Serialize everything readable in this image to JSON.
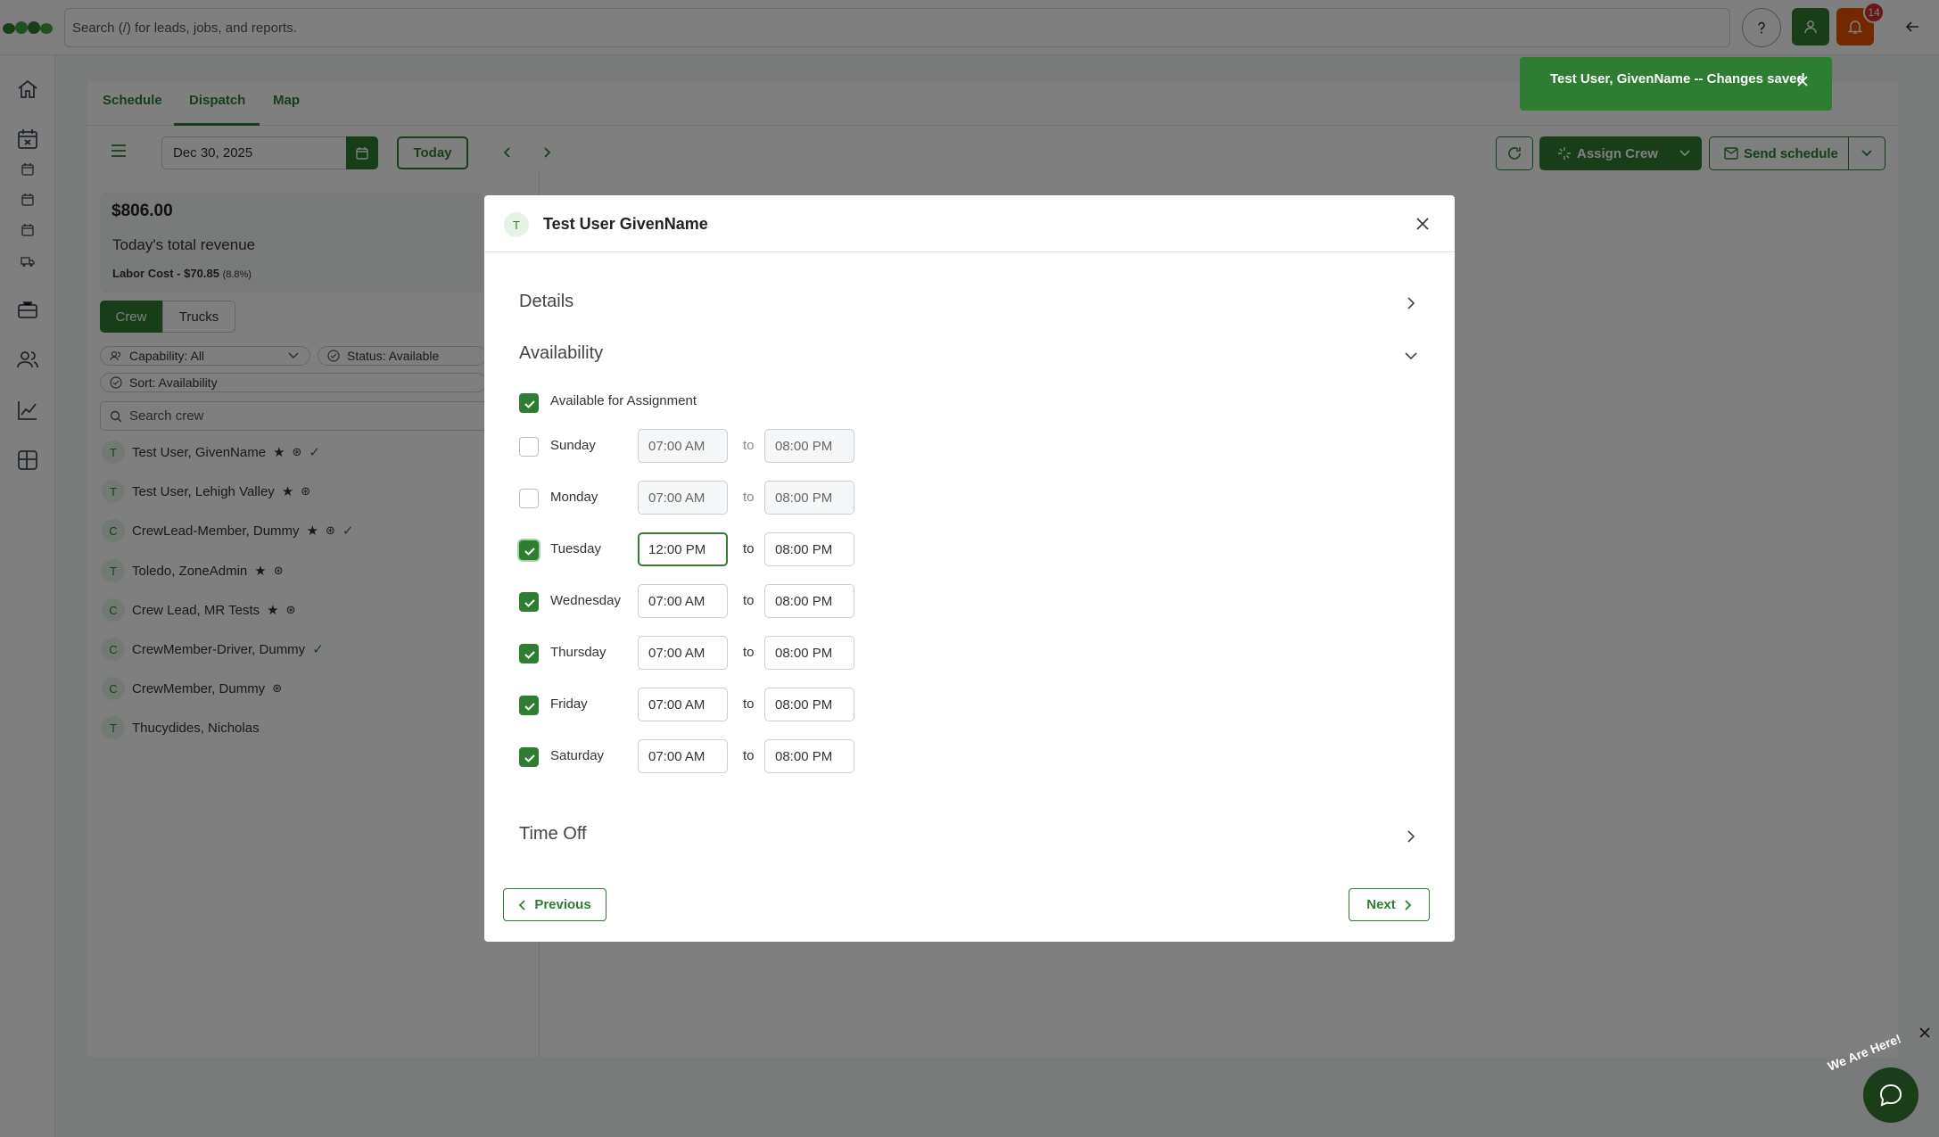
{
  "search": {
    "placeholder": "Search (/) for leads, jobs, and reports."
  },
  "notifications": {
    "count": "14"
  },
  "tabs": [
    {
      "label": "Schedule"
    },
    {
      "label": "Dispatch"
    },
    {
      "label": "Map"
    }
  ],
  "toolbar": {
    "date": "Dec 30, 2025",
    "today_label": "Today",
    "assign_label": "Assign Crew",
    "send_label": "Send schedule"
  },
  "revenue": {
    "amount": "$806.00",
    "label": "Today's total revenue",
    "labor_cost": "Labor Cost - $70.85",
    "labor_pct": "(8.8%)"
  },
  "toggle": {
    "crew": "Crew",
    "trucks": "Trucks"
  },
  "filters": {
    "capability": "Capability: All",
    "status": "Status: Available",
    "sort": "Sort: Availability"
  },
  "crew_search": {
    "placeholder": "Search crew"
  },
  "crew": [
    {
      "initial": "T",
      "name": "Test User, GivenName"
    },
    {
      "initial": "T",
      "name": "Test User, Lehigh Valley"
    },
    {
      "initial": "C",
      "name": "CrewLead-Member, Dummy"
    },
    {
      "initial": "T",
      "name": "Toledo, ZoneAdmin"
    },
    {
      "initial": "C",
      "name": "Crew Lead, MR Tests"
    },
    {
      "initial": "C",
      "name": "CrewMember-Driver, Dummy"
    },
    {
      "initial": "C",
      "name": "CrewMember, Dummy"
    },
    {
      "initial": "T",
      "name": "Thucydides, Nicholas"
    }
  ],
  "toast": {
    "message": "Test User, GivenName -- Changes saved"
  },
  "modal": {
    "avatar": "T",
    "title": "Test User GivenName",
    "sections": {
      "details": "Details",
      "availability": "Availability",
      "time_off": "Time Off"
    },
    "available_label": "Available for Assignment",
    "to_label": "to",
    "days": [
      {
        "name": "Sunday",
        "checked": false,
        "from": "07:00 AM",
        "to": "08:00 PM"
      },
      {
        "name": "Monday",
        "checked": false,
        "from": "07:00 AM",
        "to": "08:00 PM"
      },
      {
        "name": "Tuesday",
        "checked": true,
        "from": "12:00 PM",
        "to": "08:00 PM"
      },
      {
        "name": "Wednesday",
        "checked": true,
        "from": "07:00 AM",
        "to": "08:00 PM"
      },
      {
        "name": "Thursday",
        "checked": true,
        "from": "07:00 AM",
        "to": "08:00 PM"
      },
      {
        "name": "Friday",
        "checked": true,
        "from": "07:00 AM",
        "to": "08:00 PM"
      },
      {
        "name": "Saturday",
        "checked": true,
        "from": "07:00 AM",
        "to": "08:00 PM"
      }
    ],
    "previous_label": "Previous",
    "next_label": "Next"
  },
  "chat": {
    "banner": "We Are Here!"
  },
  "colors": {
    "brand": "#2e7d32",
    "alert": "#e65100",
    "badge": "#d32f2f",
    "toast": "#2e7d32"
  }
}
